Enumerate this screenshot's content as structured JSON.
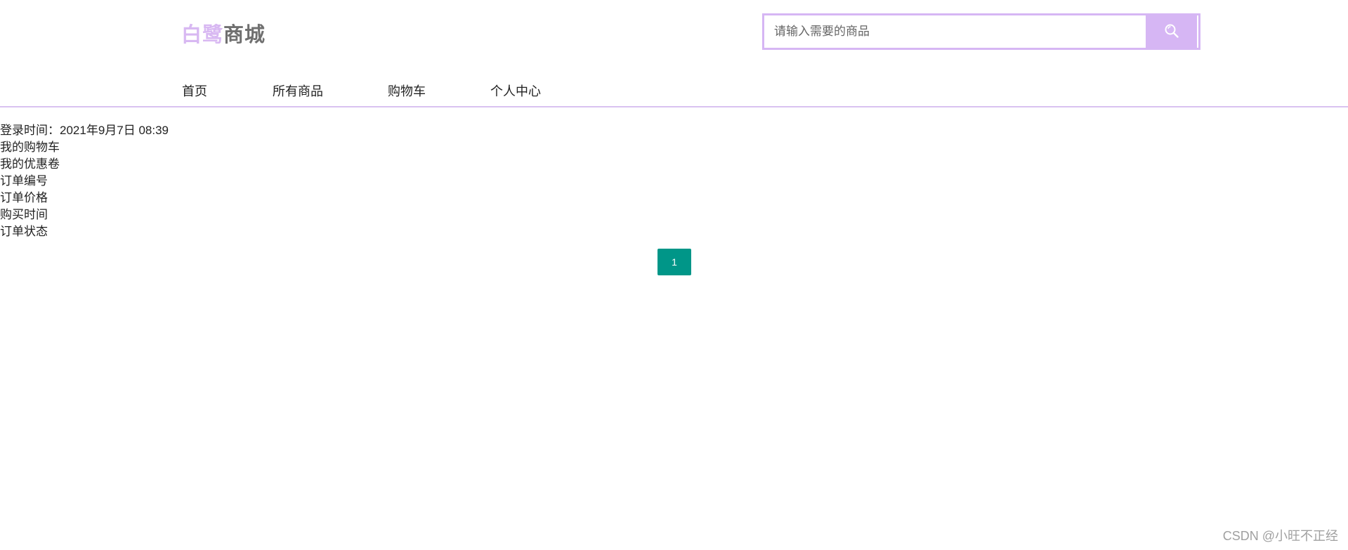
{
  "logo": {
    "part_a": "白鹭",
    "part_b": "商城"
  },
  "search": {
    "placeholder": "请输入需要的商品",
    "icon": "search-icon"
  },
  "nav": {
    "items": [
      {
        "label": "首页"
      },
      {
        "label": "所有商品"
      },
      {
        "label": "购物车"
      },
      {
        "label": "个人中心"
      }
    ]
  },
  "content": {
    "login_time": "登录时间：2021年9月7日 08:39",
    "my_cart": "我的购物车",
    "my_coupons": "我的优惠卷",
    "order_number": "订单编号",
    "order_price": "订单价格",
    "purchase_time": "购买时间",
    "order_status": "订单状态"
  },
  "pagination": {
    "current_page": "1"
  },
  "watermark": "CSDN @小旺不正经",
  "colors": {
    "accent": "#d6b6f4",
    "pagination_active": "#009688"
  }
}
